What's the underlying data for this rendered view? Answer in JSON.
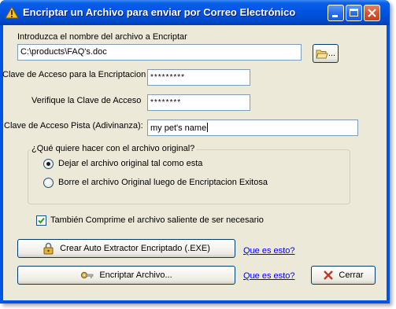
{
  "window": {
    "title": "Encriptar un Archivo para enviar por Correo Electrónico",
    "buttons": {
      "minimize": "minimize",
      "maximize": "maximize",
      "close": "close"
    }
  },
  "file": {
    "label": "Introduzca el nombre del archivo a Encriptar",
    "value": "C:\\products\\FAQ's.doc",
    "browse_label": "..."
  },
  "password": {
    "label": "Clave de Acceso para la Encriptacion",
    "value": "*********"
  },
  "verify": {
    "label": "Verifique la Clave de Acceso",
    "value": "********"
  },
  "hint": {
    "label": "Clave de Acceso Pista (Adivinanza):",
    "value": "my pet's name"
  },
  "original": {
    "group_title": "¿Qué quiere hacer con el archivo original?",
    "options": [
      {
        "label": "Dejar el archivo original tal como esta",
        "selected": true
      },
      {
        "label": "Borre el archivo Original luego de Encriptacion Exitosa",
        "selected": false
      }
    ]
  },
  "compress": {
    "label": "También Comprime el archivo saliente de ser necesario",
    "checked": true
  },
  "actions": {
    "exe_button": "Crear Auto Extractor Encriptado (.EXE)",
    "encrypt_button": "Encriptar Archivo...",
    "cancel_button": "Cerrar",
    "help_link_1": "Que es esto?",
    "help_link_2": "Que es esto?"
  },
  "colors": {
    "titlebar": "#0054e3",
    "client": "#ece9d8",
    "link": "#0000ff"
  }
}
